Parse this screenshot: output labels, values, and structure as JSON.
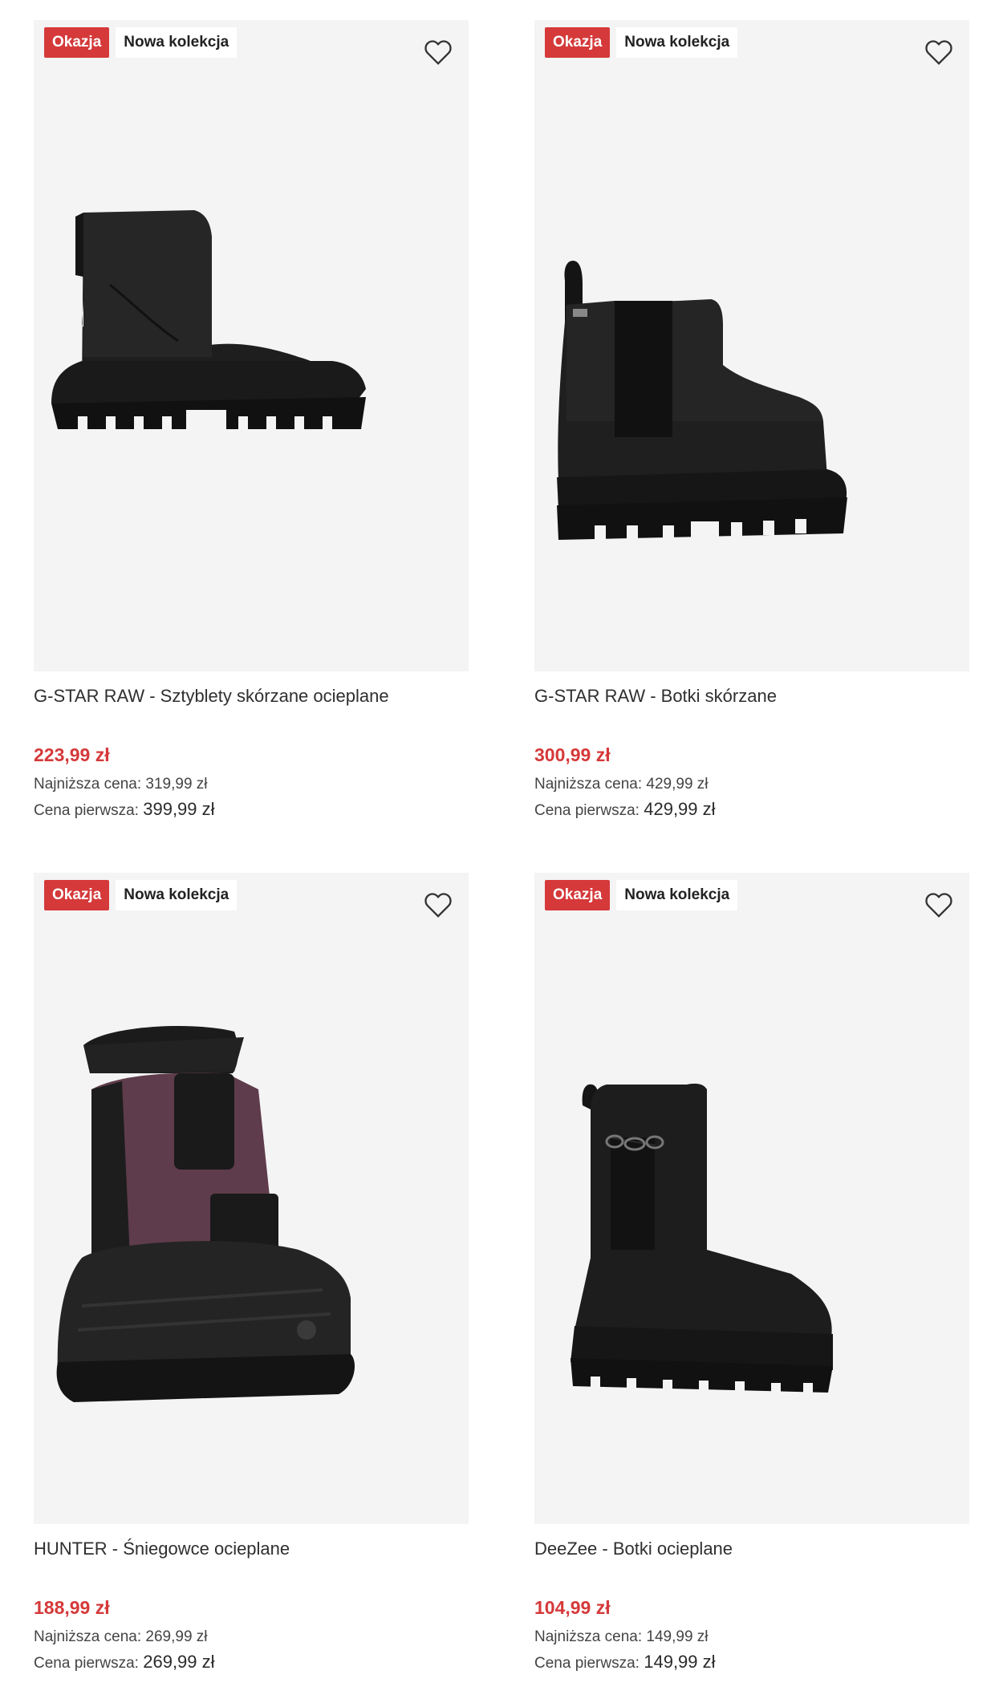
{
  "products": [
    {
      "badge_deal": "Okazja",
      "badge_new": "Nowa kolekcja",
      "title": "G-STAR RAW - Sztyblety skórzane ocieplane",
      "price": "223,99 zł",
      "lowest_label": "Najniższa cena:",
      "lowest_value": "319,99 zł",
      "original_label": "Cena pierwsza:",
      "original_value": "399,99 zł",
      "image_icon": "black-chelsea-boot-platform-icon"
    },
    {
      "badge_deal": "Okazja",
      "badge_new": "Nowa kolekcja",
      "title": "G-STAR RAW - Botki skórzane",
      "price": "300,99 zł",
      "lowest_label": "Najniższa cena:",
      "lowest_value": "429,99 zł",
      "original_label": "Cena pierwsza:",
      "original_value": "429,99 zł",
      "image_icon": "black-chelsea-boot-icon"
    },
    {
      "badge_deal": "Okazja",
      "badge_new": "Nowa kolekcja",
      "title": "HUNTER - Śniegowce ocieplane",
      "price": "188,99 zł",
      "lowest_label": "Najniższa cena:",
      "lowest_value": "269,99 zł",
      "original_label": "Cena pierwsza:",
      "original_value": "269,99 zł",
      "image_icon": "snow-boot-pink-icon"
    },
    {
      "badge_deal": "Okazja",
      "badge_new": "Nowa kolekcja",
      "title": "DeeZee - Botki ocieplane",
      "price": "104,99 zł",
      "lowest_label": "Najniższa cena:",
      "lowest_value": "149,99 zł",
      "original_label": "Cena pierwsza:",
      "original_value": "149,99 zł",
      "image_icon": "black-chain-chelsea-boot-icon"
    }
  ],
  "colors": {
    "accent_red": "#d5393a",
    "image_bg": "#f4f4f4"
  }
}
